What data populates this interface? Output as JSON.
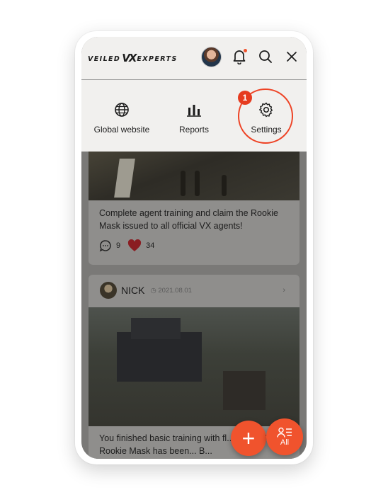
{
  "header": {
    "logo_left": "VEILED",
    "logo_mid": "VX",
    "logo_right": "EXPERTS",
    "icons": [
      "avatar",
      "bell-icon",
      "search-icon",
      "close-icon"
    ]
  },
  "menu": {
    "items": [
      {
        "label": "Global website",
        "icon": "globe-icon"
      },
      {
        "label": "Reports",
        "icon": "bar-chart-icon"
      },
      {
        "label": "Settings",
        "icon": "gear-icon"
      }
    ],
    "badge": "1",
    "highlight_color": "#ee4224"
  },
  "feed": {
    "posts": [
      {
        "text": "Complete agent training and claim the Rookie Mask issued to all official VX agents!",
        "comments": "9",
        "likes": "34"
      },
      {
        "author": "NICK",
        "date": "2021.08.01",
        "text": "You finished basic training with fl... done! Your Rookie Mask has been... B..."
      }
    ]
  },
  "fabs": {
    "add": "+",
    "all": "All"
  },
  "colors": {
    "accent": "#f0532d",
    "background": "#f1f0ee"
  }
}
